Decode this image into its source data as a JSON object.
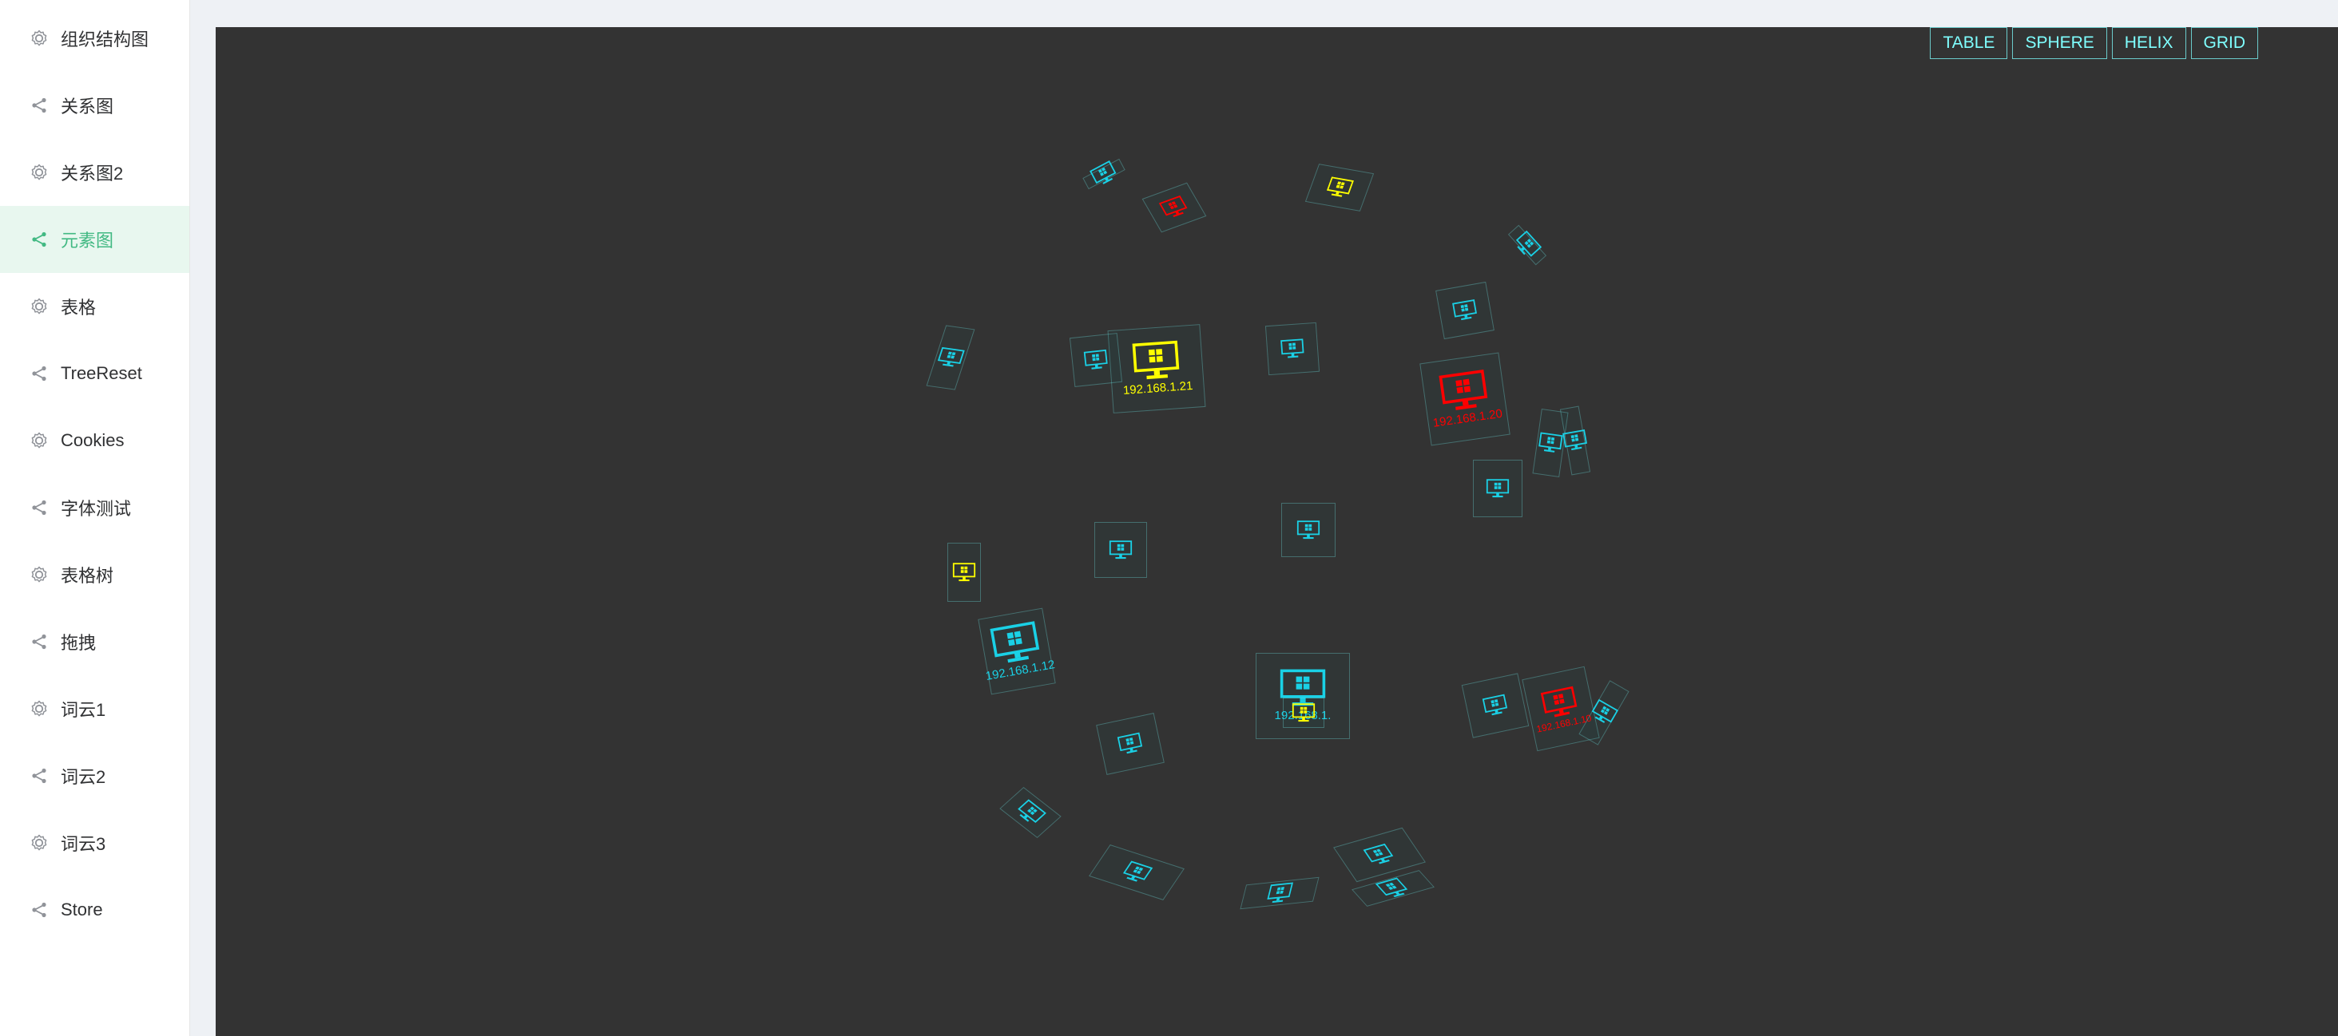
{
  "sidebar": {
    "items": [
      {
        "label": "组织结构图",
        "icon": "gear-icon"
      },
      {
        "label": "关系图",
        "icon": "share-icon"
      },
      {
        "label": "关系图2",
        "icon": "gear-icon"
      },
      {
        "label": "元素图",
        "icon": "share-icon",
        "active": true
      },
      {
        "label": "表格",
        "icon": "gear-icon"
      },
      {
        "label": "TreeReset",
        "icon": "share-icon"
      },
      {
        "label": "Cookies",
        "icon": "gear-icon"
      },
      {
        "label": "字体测试",
        "icon": "share-icon"
      },
      {
        "label": "表格树",
        "icon": "gear-icon"
      },
      {
        "label": "拖拽",
        "icon": "share-icon"
      },
      {
        "label": "词云1",
        "icon": "gear-icon"
      },
      {
        "label": "词云2",
        "icon": "share-icon"
      },
      {
        "label": "词云3",
        "icon": "gear-icon"
      },
      {
        "label": "Store",
        "icon": "share-icon"
      }
    ]
  },
  "toolbar": {
    "table_label": "TABLE",
    "sphere_label": "SPHERE",
    "helix_label": "HELIX",
    "grid_label": "GRID"
  },
  "colors": {
    "accent": "#42b983",
    "canvas_bg": "#333333",
    "cyan": "#1ad1e6",
    "yellow": "#ffff00",
    "red": "#ff0000"
  },
  "sphere": {
    "nodes": [
      {
        "label": "192.168.1.21",
        "color": "yellow"
      },
      {
        "label": "192.168.1.20",
        "color": "red"
      },
      {
        "label": "192.168.1.12",
        "color": "cyan"
      },
      {
        "label": "192.168.1.10",
        "color": "red"
      },
      {
        "label": "192.168.1.",
        "color": "cyan"
      }
    ]
  }
}
